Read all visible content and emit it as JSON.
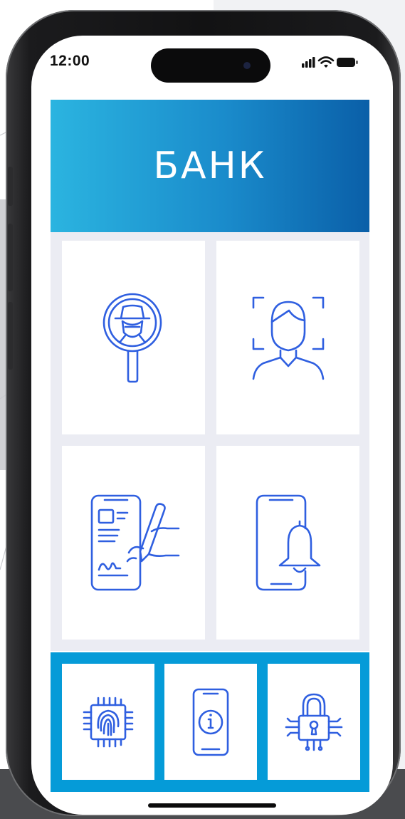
{
  "status_bar": {
    "time": "12:00"
  },
  "banner": {
    "title": "БАНК",
    "gradient_start": "#2bb4e0",
    "gradient_end": "#0a5fa8"
  },
  "tiles": [
    {
      "icon": "spy-magnifier-icon"
    },
    {
      "icon": "face-id-scan-icon"
    },
    {
      "icon": "phone-signature-icon"
    },
    {
      "icon": "phone-notification-bell-icon"
    }
  ],
  "bottom_bar": {
    "color": "#059bd8",
    "items": [
      {
        "icon": "fingerprint-chip-icon"
      },
      {
        "icon": "phone-info-icon"
      },
      {
        "icon": "cyber-lock-icon"
      }
    ]
  },
  "colors": {
    "icon_stroke": "#2f5fe0",
    "grid_background": "#ebecf3"
  }
}
